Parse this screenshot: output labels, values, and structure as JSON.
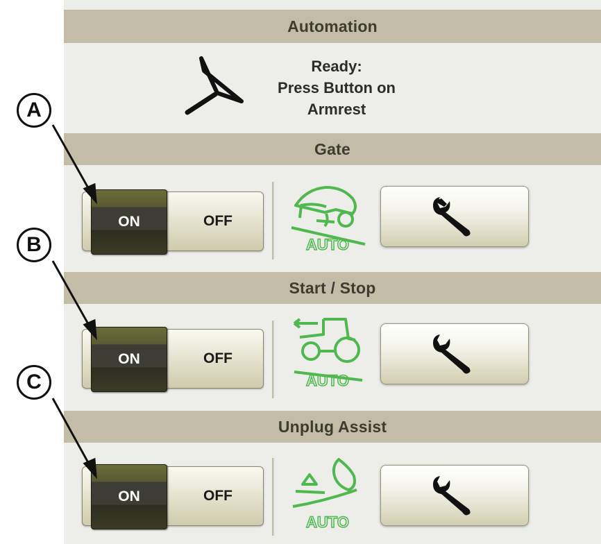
{
  "automation": {
    "title": "Automation",
    "status_line1": "Ready:",
    "status_line2": "Press Button on",
    "status_line3": "Armrest"
  },
  "sections": [
    {
      "title": "Gate",
      "on_label": "ON",
      "off_label": "OFF",
      "icon_name": "gate-auto-icon",
      "auto_label": "AUTO",
      "callout": "A"
    },
    {
      "title": "Start / Stop",
      "on_label": "ON",
      "off_label": "OFF",
      "icon_name": "tractor-auto-icon",
      "auto_label": "AUTO",
      "callout": "B"
    },
    {
      "title": "Unplug Assist",
      "on_label": "ON",
      "off_label": "OFF",
      "icon_name": "unplug-auto-icon",
      "auto_label": "AUTO",
      "callout": "C"
    }
  ],
  "colors": {
    "header_bg": "#c3bda7",
    "panel_bg": "#ededea",
    "toggle_on": "#3d3d35",
    "auto_icon_green": "#4fb84f"
  }
}
